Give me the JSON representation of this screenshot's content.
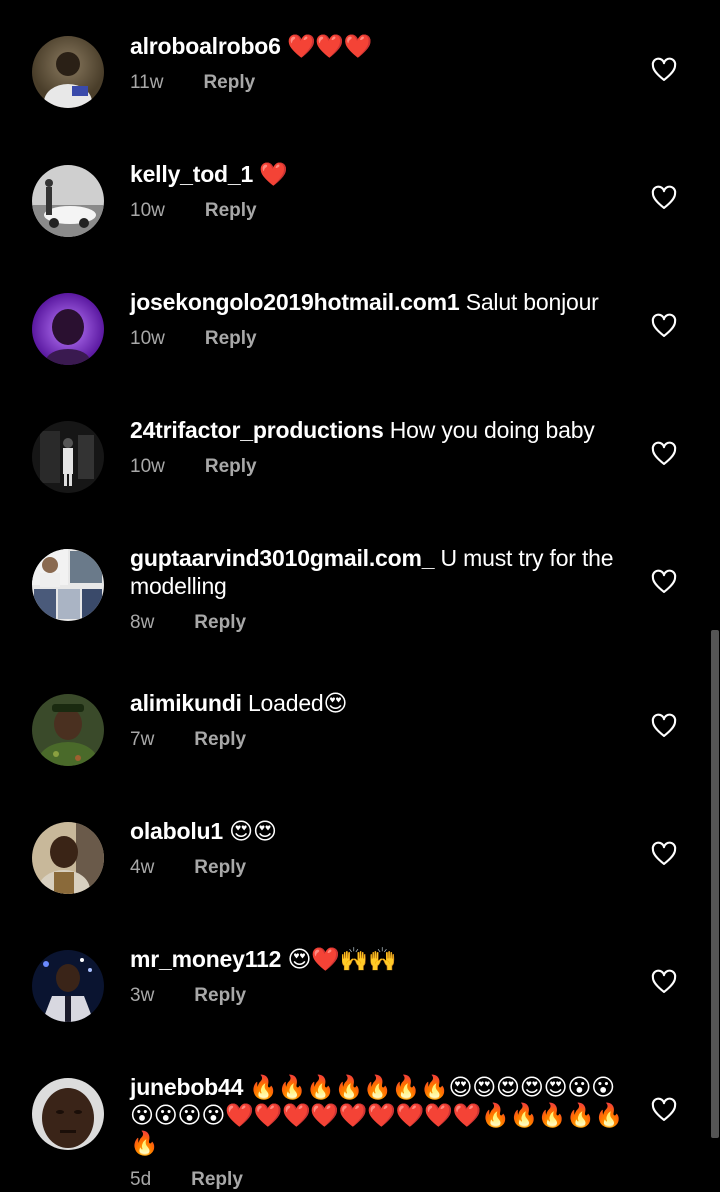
{
  "comments": [
    {
      "user": "alroboalrobo6",
      "text": "❤️❤️❤️",
      "time": "11w",
      "reply": "Reply",
      "avatar_colors": [
        "#4a3e2a",
        "#8a7a60"
      ]
    },
    {
      "user": "kelly_tod_1",
      "text": "❤️",
      "time": "10w",
      "reply": "Reply",
      "avatar_colors": [
        "#7a7a7a",
        "#d8d8d8"
      ]
    },
    {
      "user": "josekongolo2019hotmail.com1",
      "text": "Salut bonjour",
      "time": "10w",
      "reply": "Reply",
      "avatar_colors": [
        "#6a1fb0",
        "#c080ff"
      ]
    },
    {
      "user": "24trifactor_productions",
      "text": "How you doing baby",
      "time": "10w",
      "reply": "Reply",
      "avatar_colors": [
        "#1a1a1a",
        "#666666"
      ]
    },
    {
      "user": "guptaarvind3010gmail.com_",
      "text": "U must try for the modelling",
      "time": "8w",
      "reply": "Reply",
      "avatar_colors": [
        "#5a6a7a",
        "#e0e0e0"
      ]
    },
    {
      "user": "alimikundi",
      "text": "Loaded😍",
      "time": "7w",
      "reply": "Reply",
      "avatar_colors": [
        "#2a3a1a",
        "#6a7a3a"
      ]
    },
    {
      "user": "olabolu1",
      "text": "😍😍",
      "time": "4w",
      "reply": "Reply",
      "avatar_colors": [
        "#3a2a1a",
        "#9a8a6a"
      ]
    },
    {
      "user": "mr_money112",
      "text": "😍❤️🙌🙌",
      "time": "3w",
      "reply": "Reply",
      "avatar_colors": [
        "#0a1a3a",
        "#5a6aaa"
      ]
    },
    {
      "user": "junebob44",
      "text": "🔥🔥🔥🔥🔥🔥🔥😍😍😍😍😍😮😮😮😮😮😮❤️❤️❤️❤️❤️❤️❤️❤️❤️🔥🔥🔥🔥🔥🔥",
      "time": "5d",
      "reply": "Reply",
      "avatar_colors": [
        "#2a1a10",
        "#7a5a40"
      ]
    }
  ],
  "icons": {
    "like": "heart-outline-icon"
  }
}
